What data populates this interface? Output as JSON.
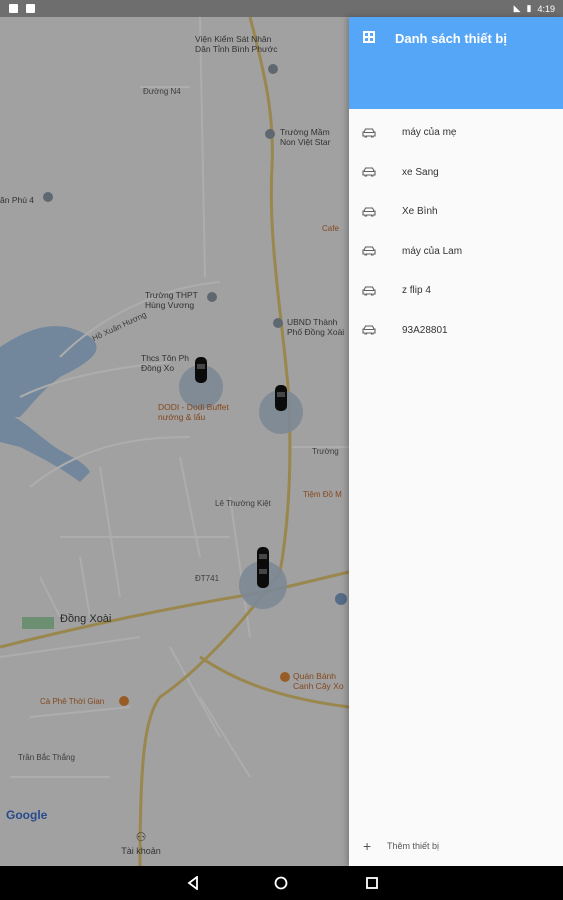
{
  "status_bar": {
    "time": "4:19"
  },
  "map": {
    "labels": {
      "vien_kiem_sat": "Viện Kiểm Sát Nhân\nDân Tỉnh Bình Phước",
      "duong_n4": "Đường N4",
      "truong_mam_non": "Trường Mầm\nNon Việt Star",
      "an_phu_4": "ăn Phú 4",
      "cafe": "Cafe",
      "truong_thpt": "Trường THPT\nHùng Vương",
      "ubnd": "UBND Thành\nPhố Đồng Xoài",
      "thcs": "Thcs Tôn Ph\nĐồng Xo",
      "dodi_buffet": "DODI - Dodi Buffet\nnướng & lẩu",
      "truong": "Trường",
      "tiem_do": "Tiệm Đồ M",
      "dong_xoai": "Đồng Xoài",
      "dt741": "ĐT741",
      "quan_banh": "Quán Bánh\nCanh Cây Xo",
      "ca_phe_thoi_gian": "Cà Phê Thời Gian",
      "tran_bac_thang": "Trần Bắc Thắng",
      "ho_xuan_huong": "Hồ Xuân Hương",
      "le_thuong_kiet": "Lê Thường Kiệt"
    },
    "google": "Google",
    "account_label": "Tài khoản"
  },
  "drawer": {
    "title": "Danh sách thiết bị",
    "devices": [
      {
        "name": "máy của mẹ"
      },
      {
        "name": "xe Sang"
      },
      {
        "name": "Xe Bình"
      },
      {
        "name": "máy của Lam"
      },
      {
        "name": "z flip 4"
      },
      {
        "name": "93A28801"
      }
    ],
    "add_device": "Thêm thiết bị"
  },
  "colors": {
    "header": "#56a6f7",
    "drawer_bg": "#fafafa",
    "navbar": "#000000"
  },
  "icons": {
    "header": "list-icon",
    "device": "car-icon",
    "add": "plus-icon",
    "nav": [
      "back-icon",
      "home-icon",
      "recents-icon"
    ]
  }
}
